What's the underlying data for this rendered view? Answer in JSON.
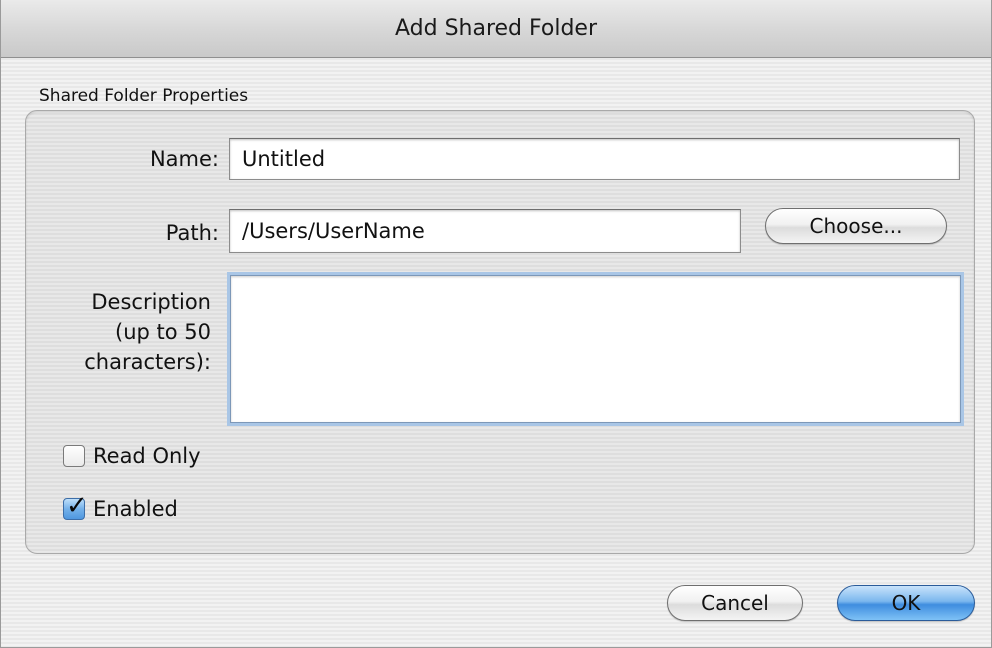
{
  "dialog": {
    "title": "Add Shared Folder",
    "group_title": "Shared Folder Properties"
  },
  "fields": {
    "name_label": "Name:",
    "name_value": "Untitled",
    "path_label": "Path:",
    "path_value": "/Users/UserName",
    "choose_button": "Choose...",
    "description_label_line1": "Description",
    "description_label_line2": "(up to 50",
    "description_label_line3": "characters):",
    "description_value": ""
  },
  "options": {
    "read_only_label": "Read Only",
    "read_only_checked": false,
    "enabled_label": "Enabled",
    "enabled_checked": true
  },
  "buttons": {
    "cancel_label": "Cancel",
    "ok_label": "OK"
  },
  "colors": {
    "default_button_accent": "#3f8ddf",
    "focus_ring": "#a9c6e6"
  }
}
